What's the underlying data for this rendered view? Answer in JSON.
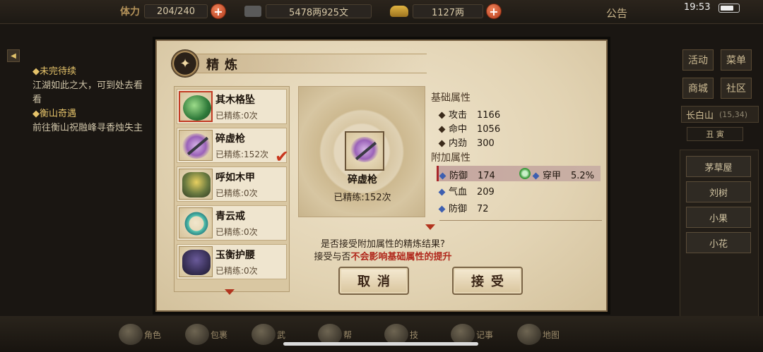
{
  "status": {
    "time": "19:53"
  },
  "topbar": {
    "stamina_label": "体力",
    "stamina": "204/240",
    "coins": "5478两925文",
    "gold": "1127两",
    "notice": "公告"
  },
  "quests": [
    {
      "title": "◆未完待续",
      "desc": "江湖如此之大，可到处去看看"
    },
    {
      "title": "◆衡山奇遇",
      "desc": "前往衡山祝融峰寻香烛失主"
    }
  ],
  "right_menu": {
    "activity": "活动",
    "menu": "菜单",
    "shop": "商城",
    "community": "社区",
    "location": "长白山",
    "location_coords": "(15,34)",
    "timeslot": "丑 寅",
    "npcs": [
      "茅草屋",
      "刘树",
      "小果",
      "小花"
    ]
  },
  "bottom_nav": [
    {
      "label": "角色",
      "icon": "character-icon"
    },
    {
      "label": "包裹",
      "icon": "bag-icon"
    },
    {
      "label": "武",
      "icon": "martial-icon"
    },
    {
      "label": "帮",
      "icon": "guild-icon"
    },
    {
      "label": "技",
      "icon": "skill-icon"
    },
    {
      "label": "记事",
      "icon": "journal-icon"
    },
    {
      "label": "地图",
      "icon": "map-icon"
    }
  ],
  "dialog": {
    "title": "精炼",
    "items": [
      {
        "name": "其木格坠",
        "count": "已精练:0次",
        "icon": "pendant-icon"
      },
      {
        "name": "碎虚枪",
        "count": "已精练:152次",
        "icon": "spear-icon"
      },
      {
        "name": "呼如木甲",
        "count": "已精练:0次",
        "icon": "armor-icon"
      },
      {
        "name": "青云戒",
        "count": "已精练:0次",
        "icon": "ring-icon"
      },
      {
        "name": "玉衡护腰",
        "count": "已精练:0次",
        "icon": "belt-icon"
      }
    ],
    "preview": {
      "name": "碎虚枪",
      "count": "已精练:152次"
    },
    "base_title": "基础属性",
    "base_attrs": [
      {
        "name": "攻击",
        "value": "1166"
      },
      {
        "name": "命中",
        "value": "1056"
      },
      {
        "name": "内劲",
        "value": "300"
      }
    ],
    "extra_title": "附加属性",
    "extra_attrs": [
      {
        "name": "防御",
        "value": "174"
      },
      {
        "name": "气血",
        "value": "209"
      },
      {
        "name": "防御",
        "value": "72"
      }
    ],
    "new_attr": {
      "name": "穿甲",
      "value": "5.2%"
    },
    "prompt_line1": "是否接受附加属性的精炼结果?",
    "prompt_line2_prefix": "接受与否",
    "prompt_line2_highlight": "不会影响基础属性的提升",
    "cancel": "取消",
    "accept": "接受",
    "colors": {
      "highlight": "#b0281c",
      "selection": "#c23b24"
    }
  }
}
